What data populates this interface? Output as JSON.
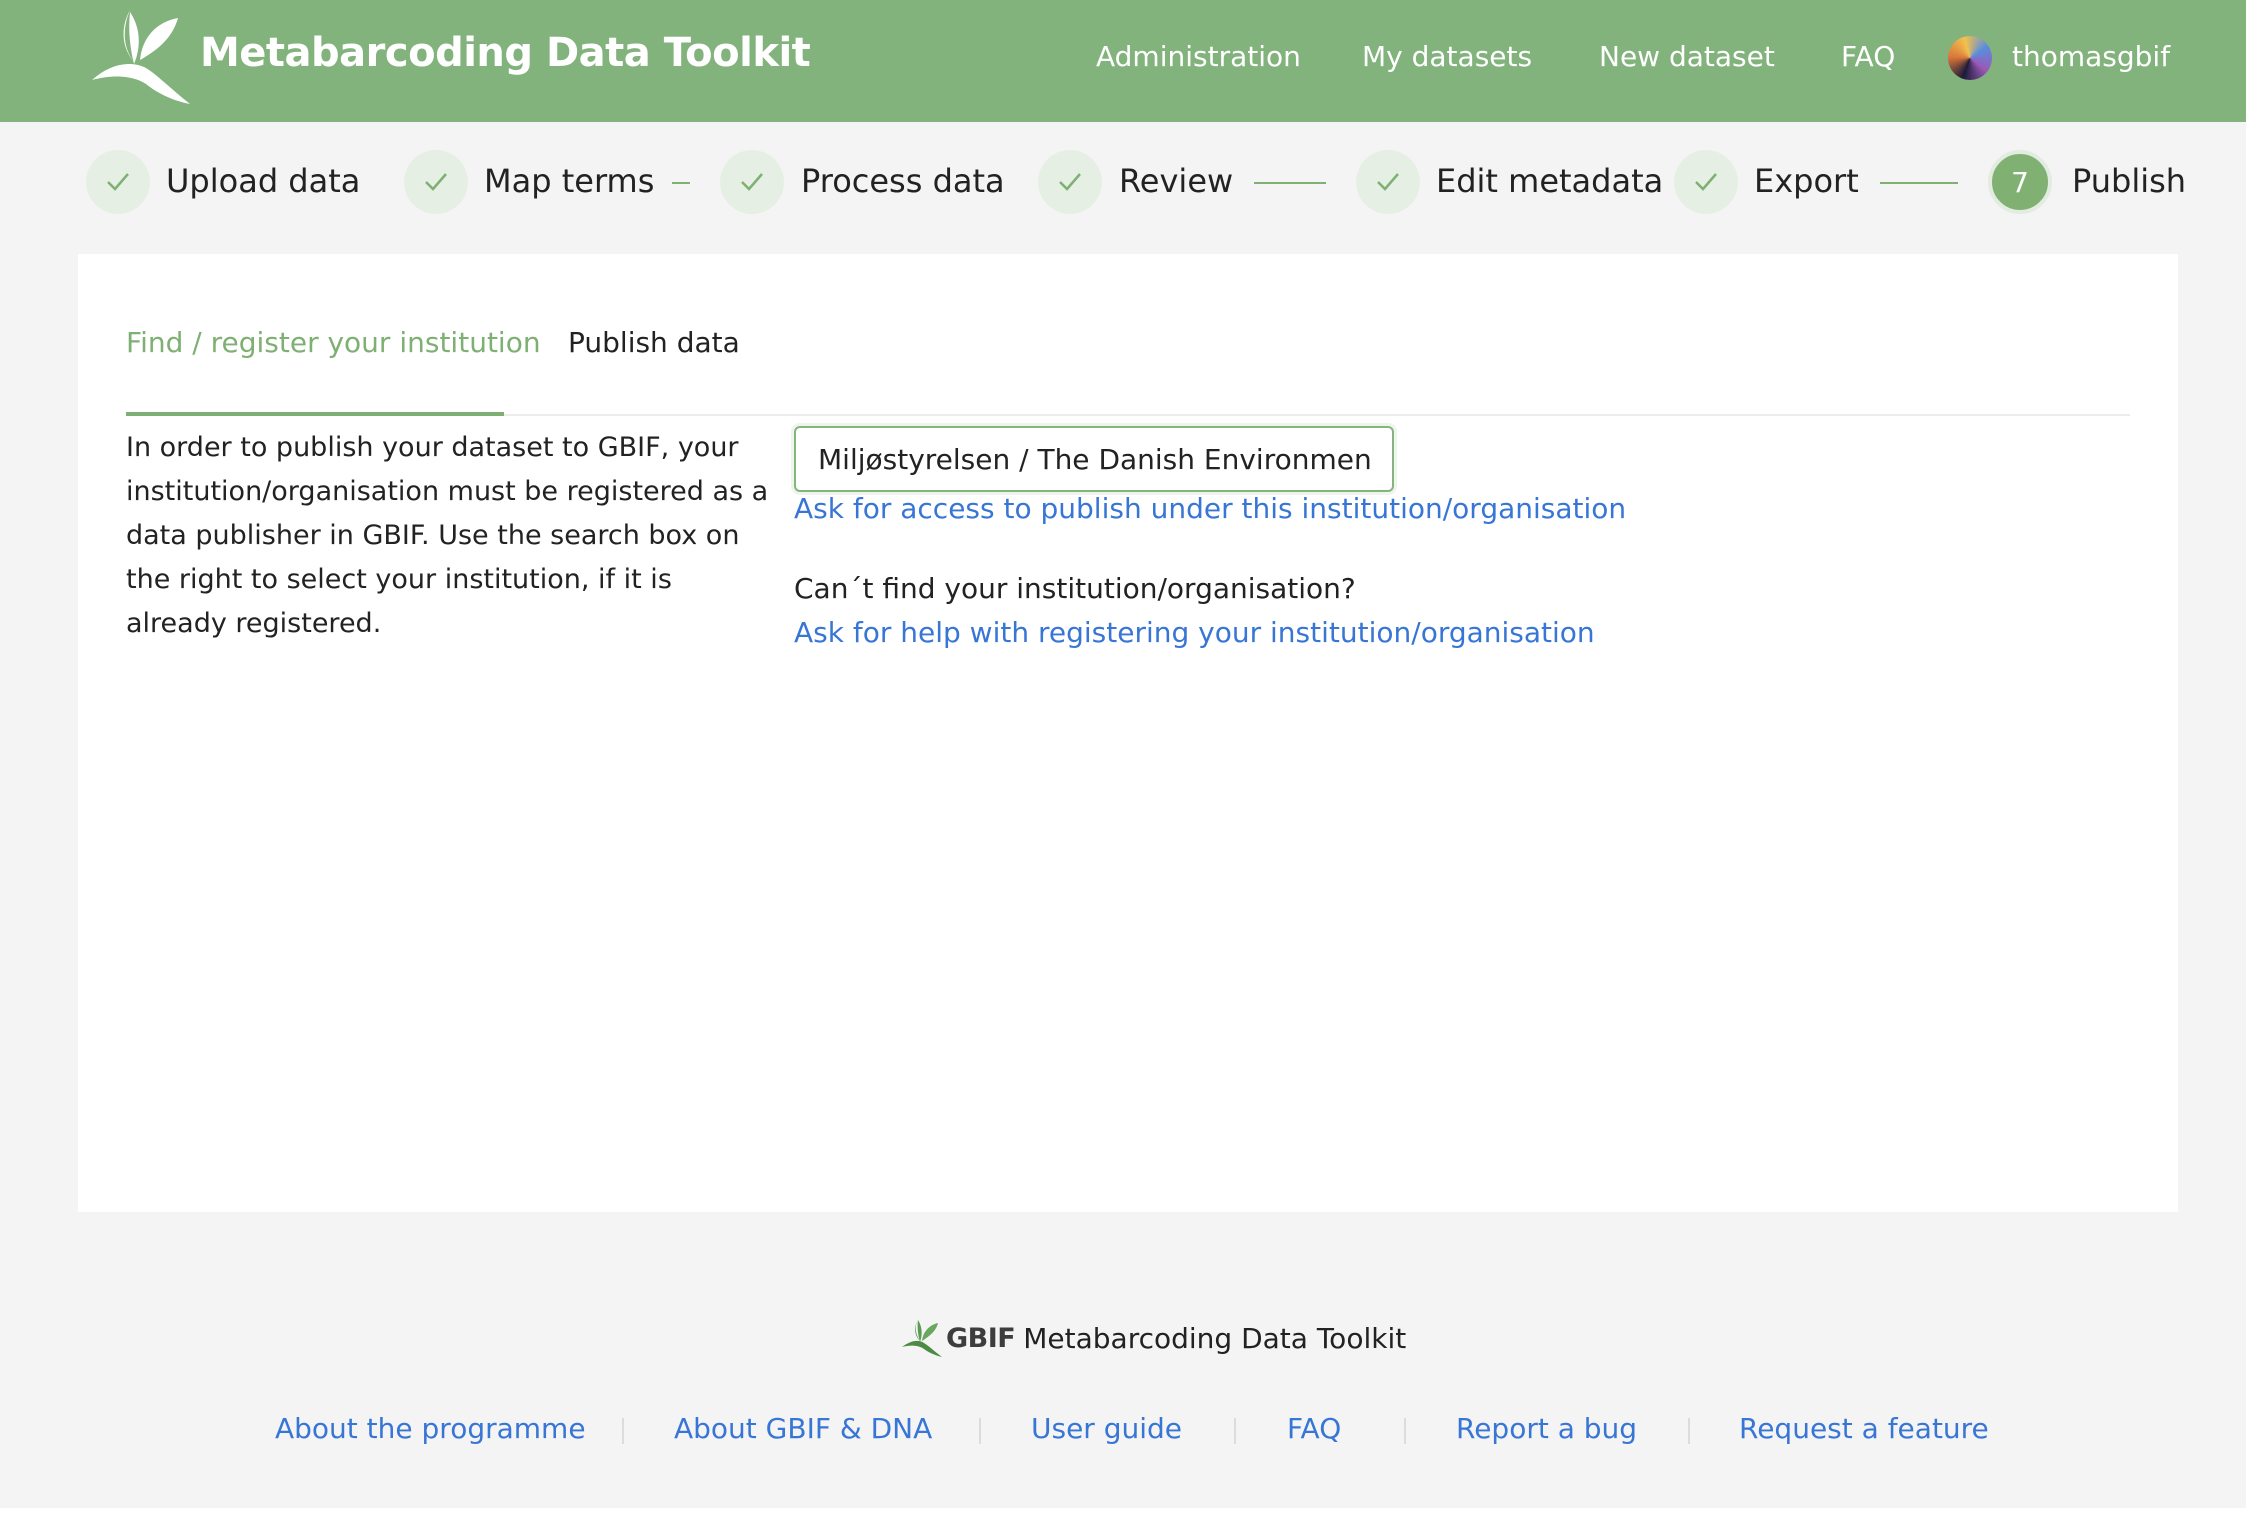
{
  "header": {
    "title": "Metabarcoding Data Toolkit",
    "logo_icon": "leaf-logo-icon",
    "nav": {
      "administration": "Administration",
      "my_datasets": "My datasets",
      "new_dataset": "New dataset",
      "faq": "FAQ",
      "username": "thomasgbif"
    }
  },
  "steps": [
    {
      "label": "Upload data",
      "status": "done"
    },
    {
      "label": "Map terms",
      "status": "done"
    },
    {
      "label": "Process data",
      "status": "done"
    },
    {
      "label": "Review",
      "status": "done"
    },
    {
      "label": "Edit metadata",
      "status": "done"
    },
    {
      "label": "Export",
      "status": "done"
    },
    {
      "label": "Publish",
      "status": "current",
      "number": "7"
    }
  ],
  "colors": {
    "brand_green": "#83b37c",
    "link_blue": "#3876d6",
    "done_circle": "#e6efe4"
  },
  "tabs": {
    "find_register": "Find / register your institution",
    "publish_data": "Publish data",
    "active": "find_register"
  },
  "main": {
    "intro_text": "In order to publish your dataset to GBIF, your institution/organisation must be registered as a data publisher in GBIF. Use the search box on the right to select your institution, if it is already registered.",
    "institution_value": "Miljøstyrelsen / The Danish Environmental Protection Agency",
    "ask_access_link": "Ask for access to publish under this institution/organisation",
    "cant_find_text": "Can´t find your institution/organisation?",
    "ask_help_link": "Ask for help with registering your institution/organisation"
  },
  "footer": {
    "gbif": "GBIF",
    "title": "Metabarcoding Data Toolkit",
    "links": {
      "about_programme": "About the programme",
      "about_gbif_dna": "About GBIF & DNA",
      "user_guide": "User guide",
      "faq": "FAQ",
      "report_bug": "Report a bug",
      "request_feature": "Request a feature"
    }
  }
}
